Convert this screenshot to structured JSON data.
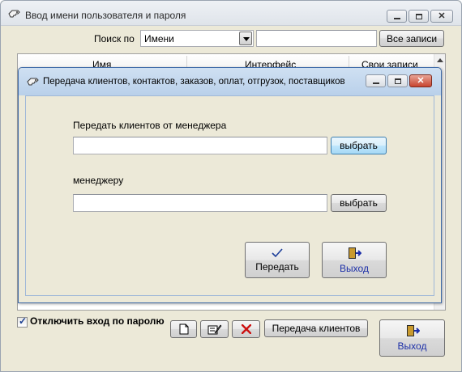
{
  "main_window": {
    "title": "Ввод имени пользователя и пароля",
    "search_label": "Поиск по",
    "search_field": "Имени",
    "all_records": "Все записи",
    "columns": [
      "Имя",
      "Интерфейс",
      "Свои записи"
    ],
    "disable_password_label": "Отключить вход по паролю",
    "disable_password_checked": true,
    "transfer_clients_button": "Передача клиентов",
    "exit_button": "Выход"
  },
  "dialog": {
    "title": "Передача клиентов, контактов, заказов, оплат, отгрузок, поставщиков",
    "from_label": "Передать клиентов от менеджера",
    "from_value": "",
    "from_select": "выбрать",
    "to_label": "менеджеру",
    "to_value": "",
    "to_select": "выбрать",
    "transfer_button": "Передать",
    "exit_button": "Выход"
  },
  "icons": {
    "app": "key-hand-icon",
    "new": "new-document-icon",
    "edit": "edit-icon",
    "delete": "delete-x-icon",
    "exit": "exit-door-icon",
    "transfer": "checkmark-icon"
  },
  "colors": {
    "window_bg": "#ece9d8",
    "exit_text": "#1c2fa8",
    "delete_red": "#cc1111"
  }
}
